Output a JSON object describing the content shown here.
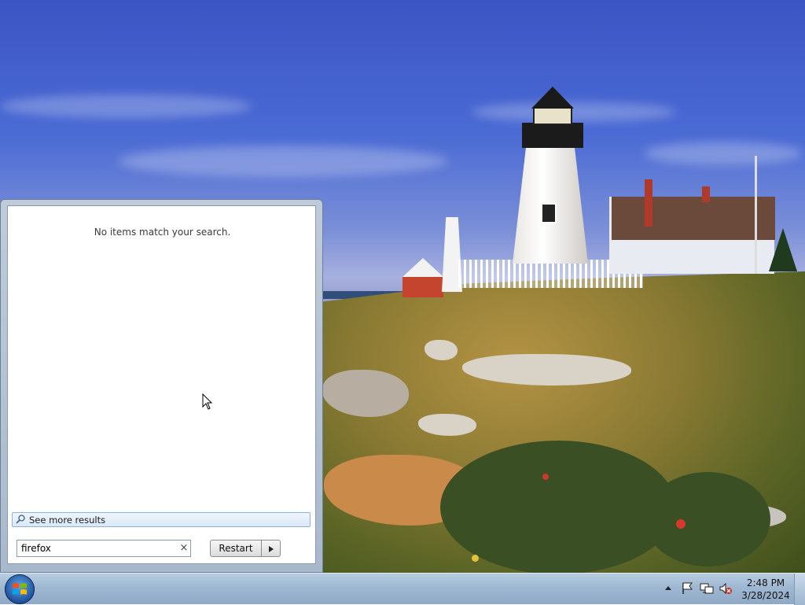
{
  "start_menu": {
    "no_results_text": "No items match your search.",
    "see_more_label": "See more results",
    "search_value": "firefox",
    "clear_glyph": "×",
    "restart_label": "Restart"
  },
  "taskbar": {
    "clock_time": "2:48 PM",
    "clock_date": "3/28/2024",
    "tray_icons": [
      "show-hidden-icons",
      "action-center-flag-icon",
      "network-icon",
      "volume-muted-icon"
    ]
  },
  "colors": {
    "taskbar": "#9fb8d2",
    "start_menu_frame": "#bfcbd9",
    "see_more_highlight": "#dbe8f8"
  }
}
